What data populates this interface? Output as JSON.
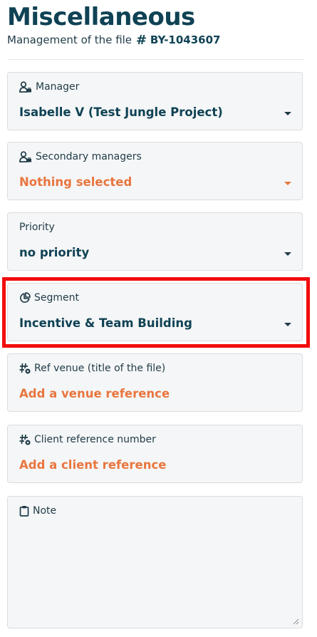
{
  "header": {
    "title": "Miscellaneous",
    "subtitle_prefix": "Management of the file",
    "file_id": "BY-1043607"
  },
  "fields": {
    "manager": {
      "label": "Manager",
      "value": "Isabelle V (Test Jungle Project)",
      "icon": "person-manager-icon"
    },
    "secondary_managers": {
      "label": "Secondary managers",
      "value": "Nothing selected",
      "icon": "person-manager-icon"
    },
    "priority": {
      "label": "Priority",
      "value": "no priority"
    },
    "segment": {
      "label": "Segment",
      "value": "Incentive & Team Building",
      "icon": "pie-chart-icon"
    },
    "ref_venue": {
      "label": "Ref venue (title of the file)",
      "value": "Add a venue reference",
      "icon": "hashtag-gear-icon"
    },
    "client_reference": {
      "label": "Client reference number",
      "value": "Add a client reference",
      "icon": "hashtag-gear-icon"
    },
    "note": {
      "label": "Note",
      "value": "",
      "icon": "clipboard-icon"
    }
  },
  "colors": {
    "primary": "#0f4254",
    "accent": "#e8763f",
    "highlight": "#f20d0d",
    "card_bg": "#f5f6f7"
  }
}
